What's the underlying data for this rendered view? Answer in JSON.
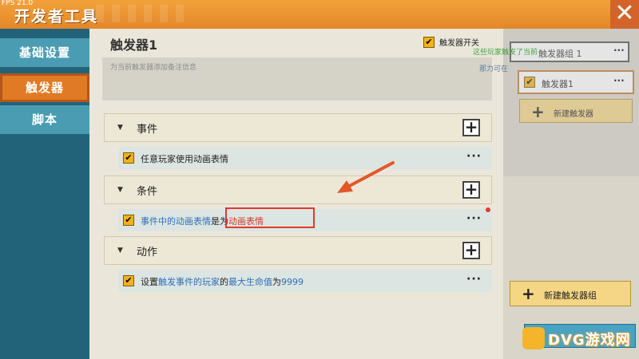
{
  "window": {
    "fps": "FPS 21.0",
    "title": "开发者工具",
    "close_glyph": "✕"
  },
  "sidebar": {
    "items": [
      {
        "label": "基础设置"
      },
      {
        "label": "触发器",
        "active": true
      },
      {
        "label": "脚本"
      }
    ]
  },
  "main": {
    "trigger_title": "触发器1",
    "switch_label": "触发器开关",
    "note_placeholder": "为当前触发器添加备注信息",
    "sections": [
      {
        "label": "事件",
        "row": {
          "parts": [
            {
              "text": "任意玩家使用动画表情"
            }
          ]
        }
      },
      {
        "label": "条件",
        "row": {
          "parts": [
            {
              "text": "事件中的动画表情",
              "style": "blue"
            },
            {
              "text": "是为"
            },
            {
              "text": "动画表情",
              "style": "red"
            }
          ]
        }
      },
      {
        "label": "动作",
        "row": {
          "parts": [
            {
              "text": "设置"
            },
            {
              "text": "触发事件的玩家",
              "style": "blue"
            },
            {
              "text": "的"
            },
            {
              "text": "最大生命值",
              "style": "blue"
            },
            {
              "text": "为"
            },
            {
              "text": "9999",
              "style": "blue"
            }
          ]
        }
      }
    ],
    "add_glyph": "+",
    "more_glyph": "···",
    "check_glyph": "✔"
  },
  "right_panel": {
    "group_label": "触发器组 1",
    "trigger_label": "触发器1",
    "new_trigger": "新建触发器",
    "new_group": "新建触发器组",
    "tip_line1": "这些玩家触发了当前",
    "tip_line2": "那力可在",
    "plus_glyph": "+"
  },
  "logo": {
    "text": "DVG游戏网"
  },
  "colors": {
    "accent": "#e3872a",
    "sidebar": "#22637a",
    "active": "#e17a24",
    "highlight": "#e4382a"
  }
}
